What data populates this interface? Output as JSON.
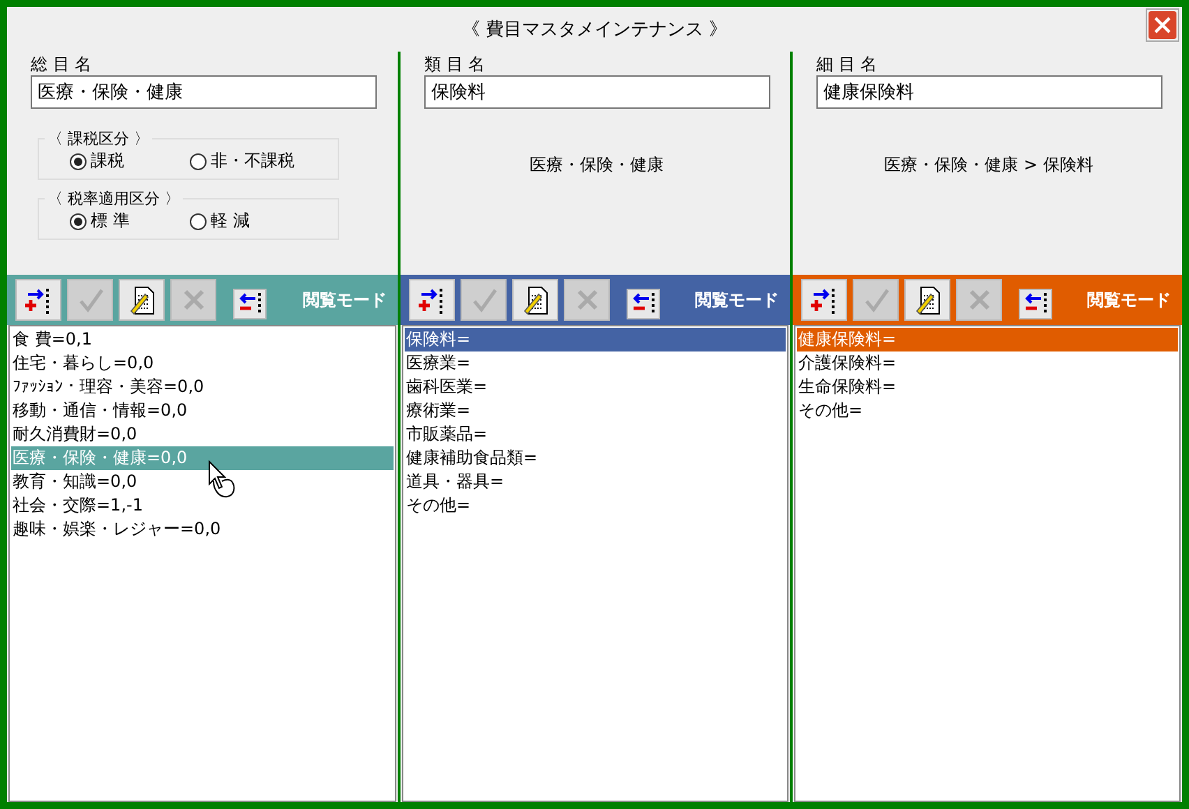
{
  "window": {
    "title": "《 費目マスタメインテナンス 》"
  },
  "panels": [
    {
      "label": "総 目 名",
      "value": "医療・保険・健康",
      "kind": "tax",
      "color": "#5aa5a0",
      "tax_groups": [
        {
          "title": "〈 課税区分 〉",
          "options": [
            {
              "label": "課税",
              "selected": true
            },
            {
              "label": "非・不課税",
              "selected": false
            }
          ]
        },
        {
          "title": "〈 税率適用区分 〉",
          "options": [
            {
              "label": "標 準",
              "selected": true
            },
            {
              "label": "軽 減",
              "selected": false
            }
          ]
        }
      ],
      "tools": [
        {
          "kind": "add",
          "disabled": false
        },
        {
          "kind": "confirm",
          "disabled": true
        },
        {
          "kind": "edit",
          "disabled": false
        },
        {
          "kind": "delete",
          "disabled": true
        },
        {
          "kind": "remove",
          "disabled": false
        }
      ],
      "mode": "閲覧モード",
      "items": [
        {
          "text": "食 費=0,1",
          "selected": false
        },
        {
          "text": "住宅・暮らし=0,0",
          "selected": false
        },
        {
          "text": "ﾌｧｯｼｮﾝ・理容・美容=0,0",
          "selected": false
        },
        {
          "text": "移動・通信・情報=0,0",
          "selected": false
        },
        {
          "text": "耐久消費財=0,0",
          "selected": false
        },
        {
          "text": "医療・保険・健康=0,0",
          "selected": true
        },
        {
          "text": "教育・知識=0,0",
          "selected": false
        },
        {
          "text": "社会・交際=1,-1",
          "selected": false
        },
        {
          "text": "趣味・娯楽・レジャー=0,0",
          "selected": false
        }
      ]
    },
    {
      "label": "類 目 名",
      "value": "保険料",
      "kind": "path",
      "color": "#4463a4",
      "path": "医療・保険・健康",
      "tools": [
        {
          "kind": "add",
          "disabled": false
        },
        {
          "kind": "confirm",
          "disabled": true
        },
        {
          "kind": "edit",
          "disabled": false
        },
        {
          "kind": "delete",
          "disabled": true
        },
        {
          "kind": "remove",
          "disabled": false
        }
      ],
      "mode": "閲覧モード",
      "items": [
        {
          "text": "保険料=",
          "selected": true
        },
        {
          "text": "医療業=",
          "selected": false
        },
        {
          "text": "歯科医業=",
          "selected": false
        },
        {
          "text": "療術業=",
          "selected": false
        },
        {
          "text": "市販薬品=",
          "selected": false
        },
        {
          "text": "健康補助食品類=",
          "selected": false
        },
        {
          "text": "道具・器具=",
          "selected": false
        },
        {
          "text": "その他=",
          "selected": false
        }
      ]
    },
    {
      "label": "細 目 名",
      "value": "健康保険料",
      "kind": "path",
      "color": "#e05c00",
      "path": "医療・保険・健康 > 保険料",
      "tools": [
        {
          "kind": "add",
          "disabled": false
        },
        {
          "kind": "confirm",
          "disabled": true
        },
        {
          "kind": "edit",
          "disabled": false
        },
        {
          "kind": "delete",
          "disabled": true
        },
        {
          "kind": "remove",
          "disabled": false
        }
      ],
      "mode": "閲覧モード",
      "items": [
        {
          "text": "健康保険料=",
          "selected": true
        },
        {
          "text": "介護保険料=",
          "selected": false
        },
        {
          "text": "生命保険料=",
          "selected": false
        },
        {
          "text": "その他=",
          "selected": false
        }
      ]
    }
  ]
}
